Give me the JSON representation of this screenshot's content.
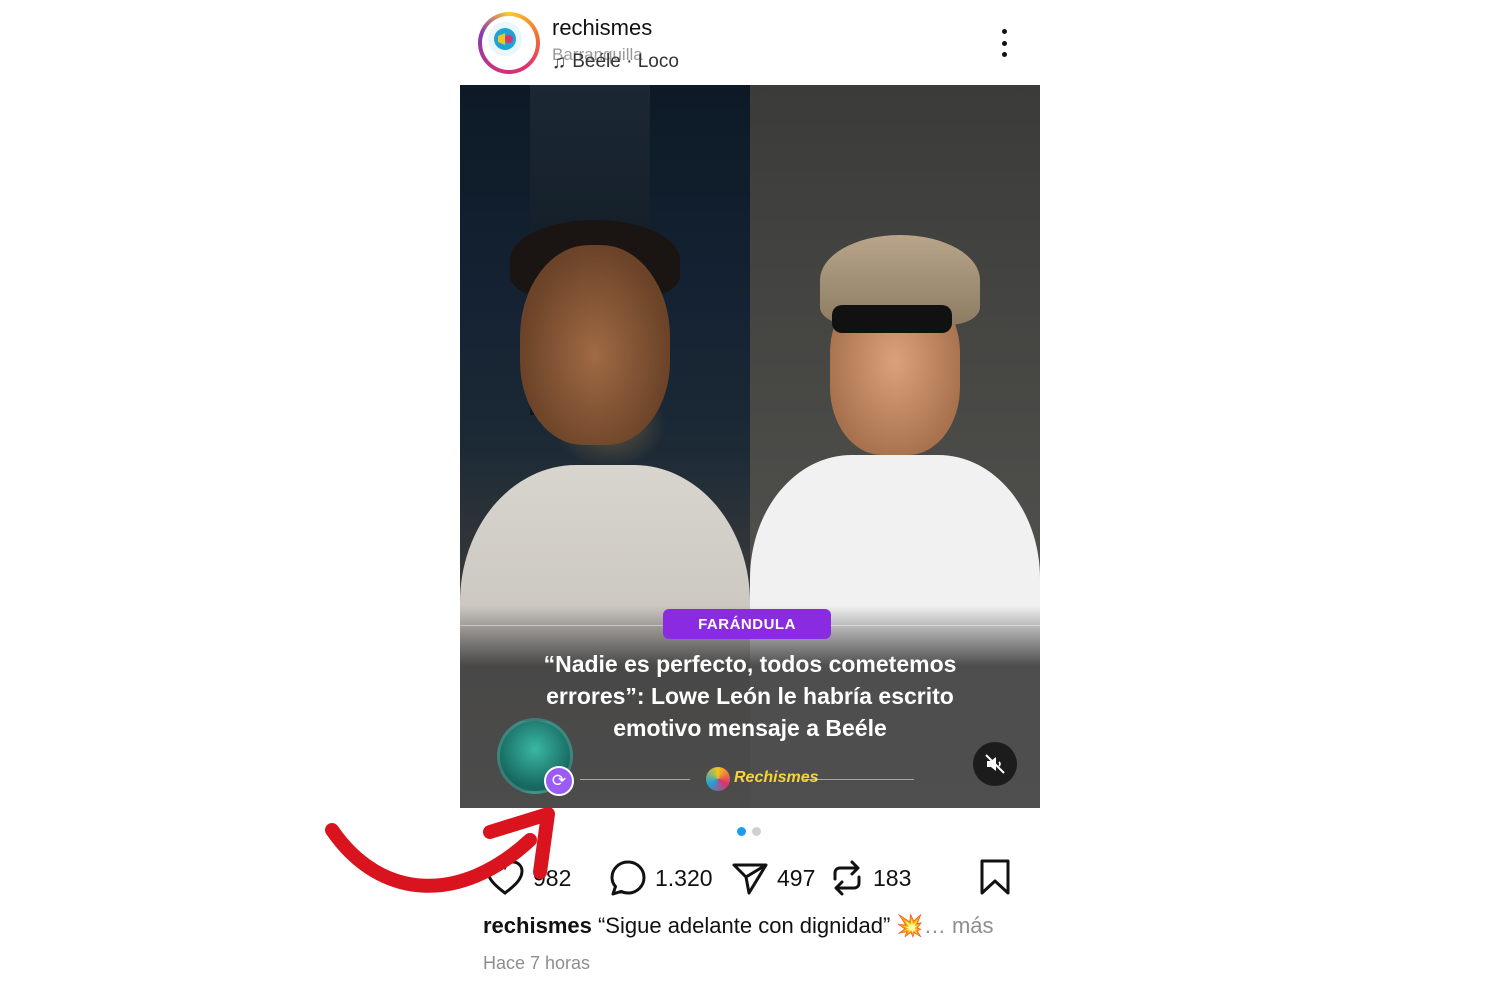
{
  "header": {
    "username": "rechismes",
    "location": "Barranquilla",
    "music": "Beéle · Loco"
  },
  "media": {
    "category": "FARÁNDULA",
    "headline": "“Nadie es perfecto, todos cometemos errores”: Lowe León le habría escrito emotivo mensaje a Beéle",
    "brand": "Rechismes",
    "category_color": "#8a2be2"
  },
  "carousel": {
    "current": 1,
    "total": 2
  },
  "actions": {
    "likes": "982",
    "comments": "1.320",
    "shares": "497",
    "reposts": "183"
  },
  "caption": {
    "username": "rechismes",
    "text": "“Sigue adelante con dignidad” 💥",
    "more": "… más"
  },
  "timestamp": "Hace 7 horas",
  "colors": {
    "annotation_arrow": "#d9141e",
    "active_dot": "#1d9bf0"
  }
}
